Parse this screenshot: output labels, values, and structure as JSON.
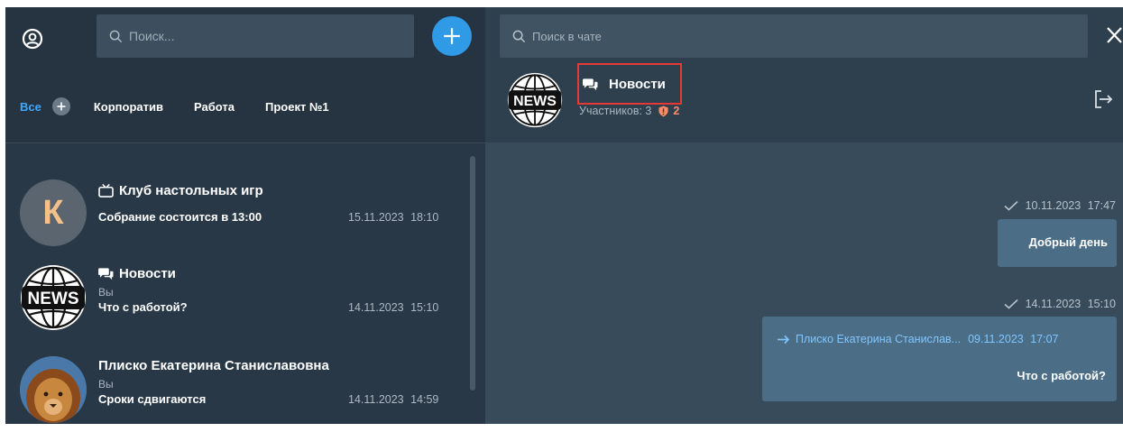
{
  "left": {
    "search_placeholder": "Поиск...",
    "tabs": [
      {
        "label": "Все",
        "active": true
      },
      {
        "label": "Корпоратив"
      },
      {
        "label": "Работа"
      },
      {
        "label": "Проект №1"
      }
    ],
    "chats": [
      {
        "avatar_letter": "К",
        "icon": "tv-icon",
        "title": "Клуб настольных игр",
        "sender": "",
        "message": "Собрание состоится в 13:00",
        "datetime": "15.11.2023 18:10"
      },
      {
        "avatar_text": "NEWS",
        "icon": "chat-bubbles-icon",
        "title": "Новости",
        "sender": "Вы",
        "message": "Что с работой?",
        "datetime": "14.11.2023 15:10"
      },
      {
        "avatar": "lion-photo",
        "title": "Плиско Екатерина Станиславовна",
        "sender": "Вы",
        "message": "Сроки сдвигаются",
        "datetime": "14.11.2023 14:59"
      }
    ]
  },
  "right": {
    "search_placeholder": "Поиск в чате",
    "header": {
      "avatar_text": "NEWS",
      "title": "Новости",
      "members": "Участников: 3",
      "warning_count": "2"
    },
    "messages": [
      {
        "datetime": "10.11.2023 17:47",
        "text": "Добрый день"
      },
      {
        "datetime": "14.11.2023 15:10",
        "forward_from": "Плиско Екатерина Станислав...",
        "forward_date": "09.11.2023 17:07",
        "text": "Что с работой?"
      }
    ]
  },
  "colors": {
    "accent": "#2f9ae6",
    "highlight_box": "#e53935",
    "warning": "#ff8a65"
  }
}
